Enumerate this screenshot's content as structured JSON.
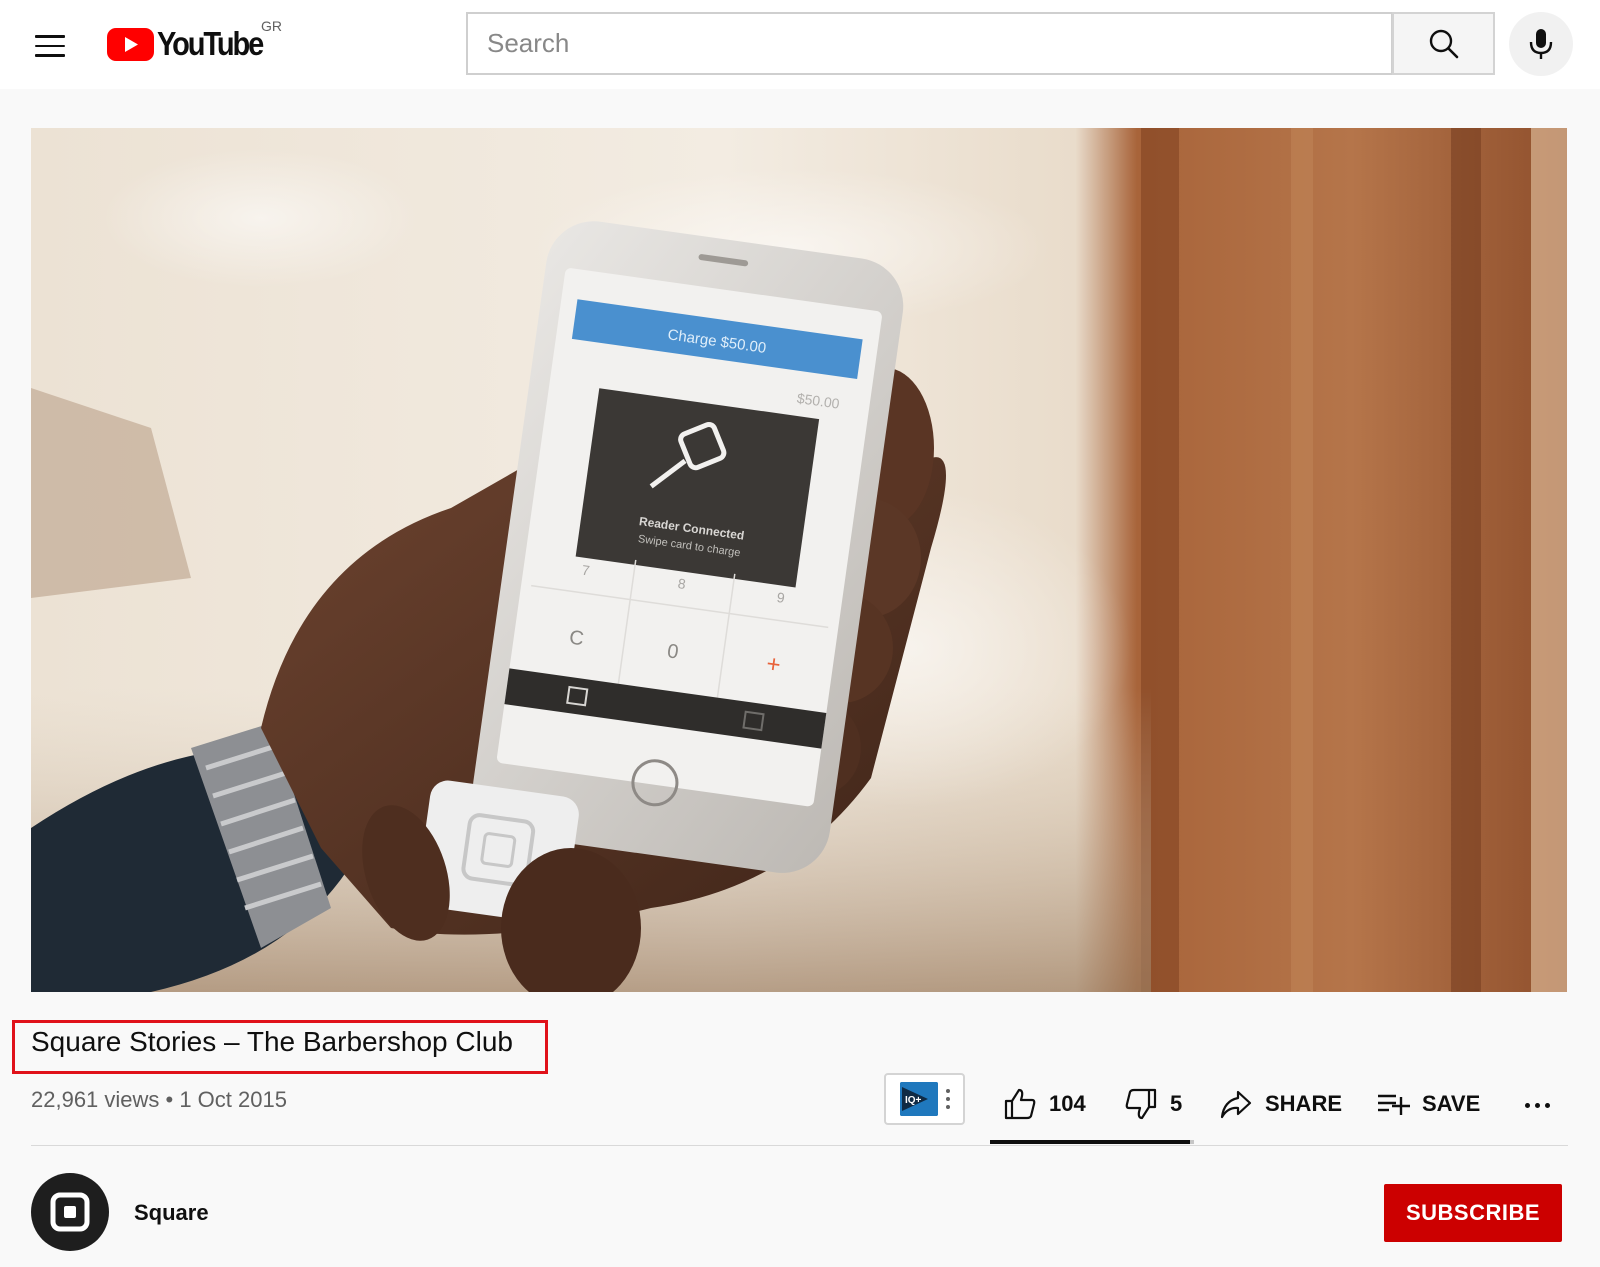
{
  "header": {
    "logo_text": "YouTube",
    "country_code": "GR",
    "search_placeholder": "Search"
  },
  "video": {
    "title": "Square Stories – The Barbershop Club",
    "meta": "22,961 views • 1 Oct 2015",
    "likes": "104",
    "dislikes": "5",
    "like_ratio": 0.98,
    "share_label": "SHARE",
    "save_label": "SAVE",
    "phone_screen": {
      "charge_label": "Charge $50.00",
      "amount": "$50.00",
      "reader_status": "Reader Connected",
      "reader_hint": "Swipe card to charge",
      "keys": [
        "7",
        "8",
        "9",
        "C",
        "0",
        "+"
      ]
    }
  },
  "channel": {
    "name": "Square",
    "subscribe_label": "SUBSCRIBE"
  },
  "colors": {
    "brand_red": "#ff0000",
    "subscribe_red": "#cc0000",
    "highlight_frame": "#e0121a"
  }
}
